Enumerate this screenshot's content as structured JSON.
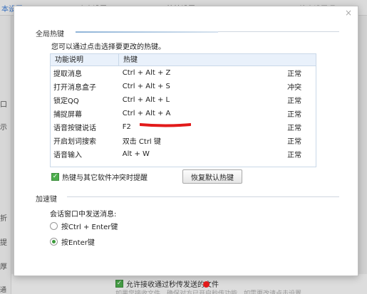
{
  "background": {
    "topbar_texts": [
      "本设置",
      "个人设置",
      "快捷设置",
      "搜索设置项"
    ],
    "left_texts": [
      "口",
      "示",
      "折",
      "提",
      "厚",
      "通话"
    ],
    "bottom_checkbox_label": "允许接收通过秒传发送的文件",
    "bottom_sub_text": "如果您接收文件，确保对方已开启秒传功能。如需更改请点击设置"
  },
  "dialog": {
    "close_glyph": "×",
    "global_section_title": "全局热键",
    "hint": "您可以通过点击选择要更改的热键。",
    "table": {
      "headers": [
        "功能说明",
        "热键"
      ],
      "rows": [
        {
          "func": "提取消息",
          "key": "Ctrl + Alt + Z",
          "status": "正常"
        },
        {
          "func": "打开消息盒子",
          "key": "Ctrl + Alt + S",
          "status": "冲突"
        },
        {
          "func": "锁定QQ",
          "key": "Ctrl + Alt + L",
          "status": "正常"
        },
        {
          "func": "捕捉屏幕",
          "key": "Ctrl + Alt + A",
          "status": "正常"
        },
        {
          "func": "语音按键说话",
          "key": "F2",
          "status": "正常"
        },
        {
          "func": "开启划词搜索",
          "key": "双击 Ctrl 键",
          "status": "正常"
        },
        {
          "func": "语音输入",
          "key": "Alt + W",
          "status": "正常"
        }
      ]
    },
    "conflict_checkbox_label": "热键与其它软件冲突时提醒",
    "restore_button_label": "恢复默认热键",
    "accel_section_title": "加速键",
    "send_label": "会话窗口中发送消息:",
    "radio_options": [
      "按Ctrl + Enter键",
      "按Enter键"
    ],
    "radio_selected": "按Enter键"
  },
  "colors": {
    "accent_green": "#4cae4c",
    "annotation_red": "#e21a1a",
    "table_header_bg": "#e9f1fb"
  }
}
